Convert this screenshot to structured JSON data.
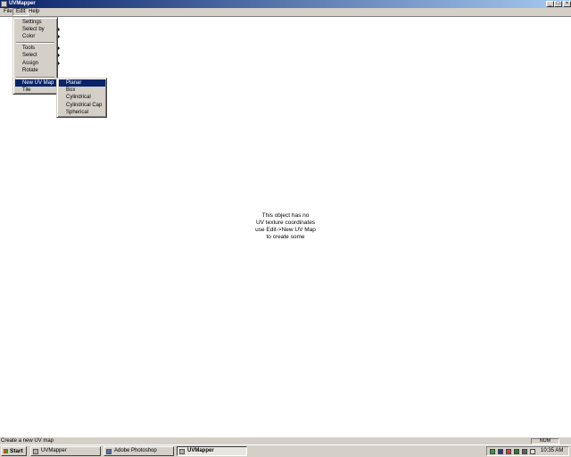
{
  "window": {
    "title": "UVMapper"
  },
  "titlebar_buttons": {
    "minimize": "_",
    "maximize": "□",
    "close": "×"
  },
  "menubar": {
    "items": [
      "File",
      "Edit",
      "Help"
    ]
  },
  "edit_menu": {
    "items": [
      "Settings",
      "Select by",
      "Color",
      "Tools",
      "Select",
      "Assign",
      "Rotate",
      "New UV Map",
      "Tile"
    ]
  },
  "new_uv_map_menu": {
    "items": [
      "Planar",
      "Box",
      "Cylindrical",
      "Cylindrical Cap",
      "Spherical"
    ]
  },
  "message": {
    "lines": [
      "This object has no",
      "UV texture coordinates",
      "use Edit->New UV Map",
      "to create some"
    ]
  },
  "statusbar": {
    "text": "Create a new UV map",
    "num": "NUM"
  },
  "taskbar": {
    "start": "Start",
    "tasks": [
      "UVMapper",
      "Adobe Photoshop",
      "UVMapper"
    ],
    "clock": "10:35 AM"
  },
  "colors": {
    "titlebar": "#0a246a",
    "highlight": "#0a246a",
    "chrome": "#d4d0c8"
  }
}
